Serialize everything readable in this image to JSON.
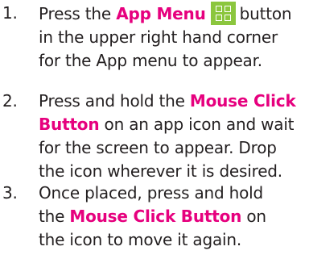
{
  "steps": [
    {
      "number": "1.",
      "line1_before": "Press the ",
      "line1_highlight": "App Menu",
      "line1_after": "button",
      "icon": "app-menu-grid-icon",
      "line2": "in the upper right hand corner",
      "line3": "for the App menu to appear."
    },
    {
      "number": "2.",
      "line1_before": "Press and hold the ",
      "line1_highlight": "Mouse Click",
      "line2_highlight": "Button",
      "line2_after": " on an app icon and wait",
      "line3": "for the screen to appear. Drop",
      "line4": "the icon wherever it is desired."
    },
    {
      "number": "3.",
      "line1": "Once placed, press and hold",
      "line2_before": "the ",
      "line2_highlight": "Mouse Click Button",
      "line2_after": " on",
      "line3": "the icon to move it again."
    }
  ],
  "colors": {
    "highlight": "#e6007e",
    "icon_background": "#8bc63e",
    "text": "#231f20"
  }
}
